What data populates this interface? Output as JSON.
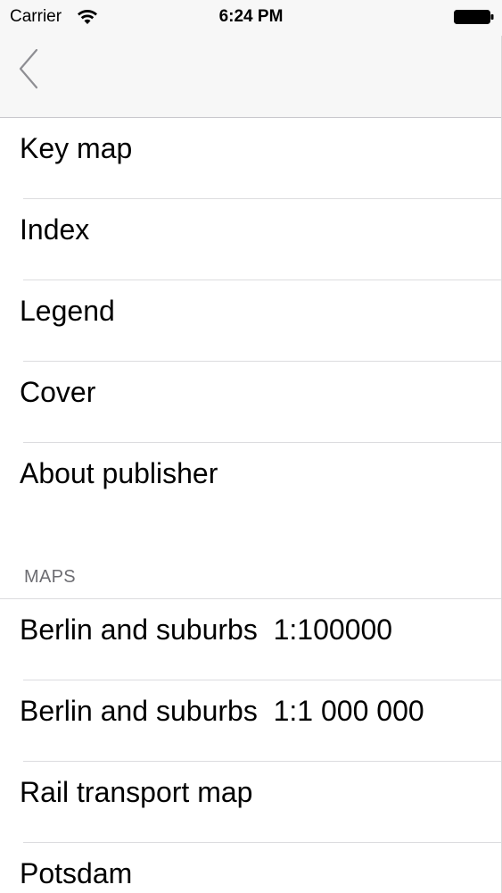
{
  "status_bar": {
    "carrier": "Carrier",
    "time": "6:24 PM"
  },
  "nav": {
    "back_icon": "chevron-left-icon"
  },
  "menu": {
    "items": [
      {
        "label": "Key map"
      },
      {
        "label": "Index"
      },
      {
        "label": "Legend"
      },
      {
        "label": "Cover"
      },
      {
        "label": "About publisher"
      }
    ]
  },
  "maps": {
    "header": "MAPS",
    "items": [
      {
        "label": "Berlin and suburbs  1:100000"
      },
      {
        "label": "Berlin and suburbs  1:1 000 000"
      },
      {
        "label": "Rail transport map"
      },
      {
        "label": "Potsdam"
      }
    ]
  },
  "colors": {
    "separator": "#dcdcdf",
    "section_header": "#6d6d72",
    "back_tint": "#8e8e93"
  }
}
